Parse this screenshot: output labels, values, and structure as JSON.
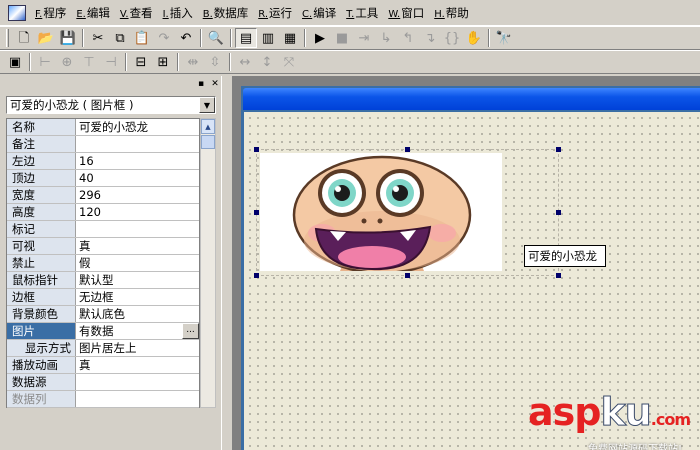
{
  "menu": [
    {
      "accel": "F.",
      "label": "程序"
    },
    {
      "accel": "E.",
      "label": "编辑"
    },
    {
      "accel": "V.",
      "label": "查看"
    },
    {
      "accel": "I.",
      "label": "插入"
    },
    {
      "accel": "B.",
      "label": "数据库"
    },
    {
      "accel": "R.",
      "label": "运行"
    },
    {
      "accel": "C.",
      "label": "编译"
    },
    {
      "accel": "T.",
      "label": "工具"
    },
    {
      "accel": "W.",
      "label": "窗口"
    },
    {
      "accel": "H.",
      "label": "帮助"
    }
  ],
  "panel": {
    "object_selector": "可爱的小恐龙 ( 图片框 )",
    "properties": [
      {
        "name": "名称",
        "value": "可爱的小恐龙"
      },
      {
        "name": "备注",
        "value": ""
      },
      {
        "name": "左边",
        "value": "16"
      },
      {
        "name": "顶边",
        "value": "40"
      },
      {
        "name": "宽度",
        "value": "296"
      },
      {
        "name": "高度",
        "value": "120"
      },
      {
        "name": "标记",
        "value": ""
      },
      {
        "name": "可视",
        "value": "真"
      },
      {
        "name": "禁止",
        "value": "假"
      },
      {
        "name": "鼠标指针",
        "value": "默认型"
      },
      {
        "name": "边框",
        "value": "无边框"
      },
      {
        "name": "背景颜色",
        "value": "默认底色"
      },
      {
        "name": "图片",
        "value": "有数据",
        "selected": true
      },
      {
        "name": "显示方式",
        "value": "图片居左上"
      },
      {
        "name": "播放动画",
        "value": "真"
      },
      {
        "name": "数据源",
        "value": ""
      },
      {
        "name": "数据列",
        "value": ""
      }
    ],
    "ellipsis_label": "..."
  },
  "design": {
    "label_text": "可爱的小恐龙"
  },
  "watermark": {
    "asp": "asp",
    "ku": "ku",
    "com": ".com",
    "sub": "免费网站源码下载站!"
  },
  "colors": {
    "selected_row": "#3a6ea5",
    "title_bar": "#0b55e8",
    "watermark_red": "#e52222"
  }
}
